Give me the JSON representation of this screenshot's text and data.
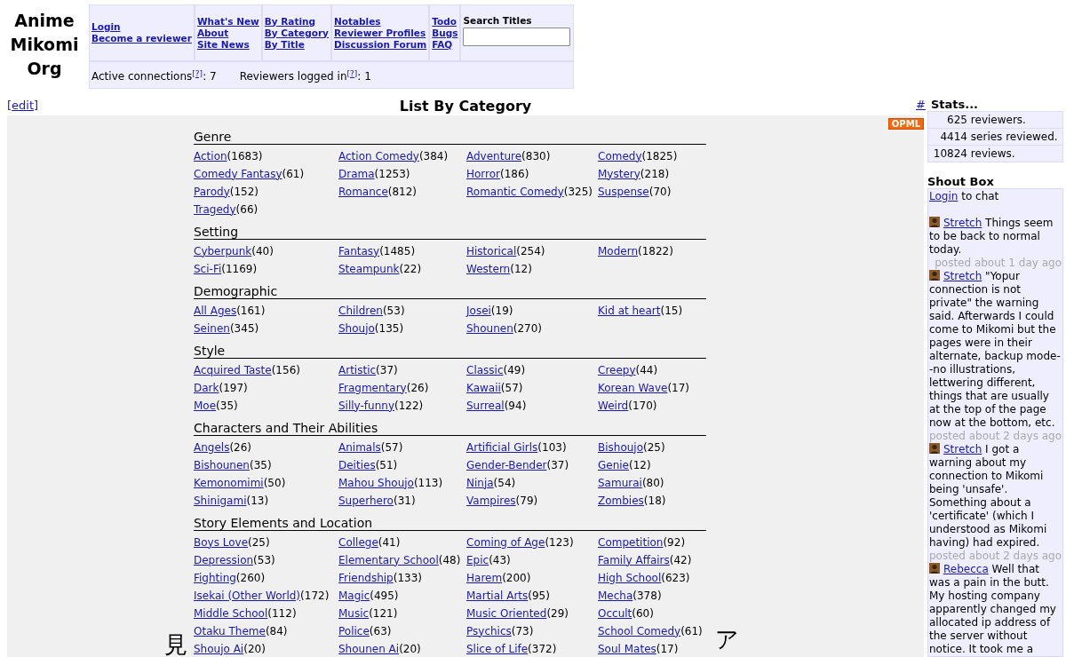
{
  "logo": "Anime Mikomi Org",
  "nav": {
    "groups": [
      [
        "Login",
        "Become a reviewer"
      ],
      [
        "What's New",
        "About",
        "Site News"
      ],
      [
        "By Rating",
        "By Category",
        "By Title"
      ],
      [
        "Notables",
        "Reviewer Profiles",
        "Discussion Forum"
      ],
      [
        "Todo",
        "Bugs",
        "FAQ"
      ]
    ],
    "search": {
      "label": "Search Titles"
    }
  },
  "status": [
    {
      "label": "Active connections",
      "help": "[?]",
      "value": ": 7"
    },
    {
      "label": "Reviewers logged in",
      "help": "[?]",
      "value": ": 1"
    }
  ],
  "edit_link": "[edit]",
  "page_title": "List By Category",
  "opml_badge": "OPML",
  "sections": [
    {
      "title": "Genre",
      "items": [
        {
          "name": "Action",
          "count": "(1683)"
        },
        {
          "name": "Action Comedy",
          "count": "(384)"
        },
        {
          "name": "Adventure",
          "count": "(830)"
        },
        {
          "name": "Comedy",
          "count": "(1825)"
        },
        {
          "name": "Comedy Fantasy",
          "count": "(61)"
        },
        {
          "name": "Drama",
          "count": "(1253)"
        },
        {
          "name": "Horror",
          "count": "(186)"
        },
        {
          "name": "Mystery",
          "count": "(218)"
        },
        {
          "name": "Parody",
          "count": "(152)"
        },
        {
          "name": "Romance",
          "count": "(812)"
        },
        {
          "name": "Romantic Comedy",
          "count": "(325)"
        },
        {
          "name": "Suspense",
          "count": "(70)"
        },
        {
          "name": "Tragedy",
          "count": "(66)"
        }
      ]
    },
    {
      "title": "Setting",
      "items": [
        {
          "name": "Cyberpunk",
          "count": "(40)"
        },
        {
          "name": "Fantasy",
          "count": "(1485)"
        },
        {
          "name": "Historical",
          "count": "(254)"
        },
        {
          "name": "Modern",
          "count": "(1822)"
        },
        {
          "name": "Sci-Fi",
          "count": "(1169)"
        },
        {
          "name": "Steampunk",
          "count": "(22)"
        },
        {
          "name": "Western",
          "count": "(12)"
        }
      ]
    },
    {
      "title": "Demographic",
      "items": [
        {
          "name": "All Ages",
          "count": "(161)"
        },
        {
          "name": "Children",
          "count": "(53)"
        },
        {
          "name": "Josei",
          "count": "(19)"
        },
        {
          "name": "Kid at heart",
          "count": "(15)"
        },
        {
          "name": "Seinen",
          "count": "(345)"
        },
        {
          "name": "Shoujo",
          "count": "(135)"
        },
        {
          "name": "Shounen",
          "count": "(270)"
        }
      ]
    },
    {
      "title": "Style",
      "items": [
        {
          "name": "Acquired Taste",
          "count": "(156)"
        },
        {
          "name": "Artistic",
          "count": "(37)"
        },
        {
          "name": "Classic",
          "count": "(49)"
        },
        {
          "name": "Creepy",
          "count": "(44)"
        },
        {
          "name": "Dark",
          "count": "(197)"
        },
        {
          "name": "Fragmentary",
          "count": "(26)"
        },
        {
          "name": "Kawaii",
          "count": "(57)"
        },
        {
          "name": "Korean Wave",
          "count": "(17)"
        },
        {
          "name": "Moe",
          "count": "(35)"
        },
        {
          "name": "Silly-funny",
          "count": "(122)"
        },
        {
          "name": "Surreal",
          "count": "(94)"
        },
        {
          "name": "Weird",
          "count": "(170)"
        }
      ]
    },
    {
      "title": "Characters and Their Abilities",
      "items": [
        {
          "name": "Angels",
          "count": "(26)"
        },
        {
          "name": "Animals",
          "count": "(57)"
        },
        {
          "name": "Artificial Girls",
          "count": "(103)"
        },
        {
          "name": "Bishoujo",
          "count": "(25)"
        },
        {
          "name": "Bishounen",
          "count": "(35)"
        },
        {
          "name": "Deities",
          "count": "(51)"
        },
        {
          "name": "Gender-Bender",
          "count": "(37)"
        },
        {
          "name": "Genie",
          "count": "(12)"
        },
        {
          "name": "Kemonomimi",
          "count": "(50)"
        },
        {
          "name": "Mahou Shoujo",
          "count": "(113)"
        },
        {
          "name": "Ninja",
          "count": "(54)"
        },
        {
          "name": "Samurai",
          "count": "(80)"
        },
        {
          "name": "Shinigami",
          "count": "(13)"
        },
        {
          "name": "Superhero",
          "count": "(31)"
        },
        {
          "name": "Vampires",
          "count": "(79)"
        },
        {
          "name": "Zombies",
          "count": "(18)"
        }
      ]
    },
    {
      "title": "Story Elements and Location",
      "items": [
        {
          "name": "Boys Love",
          "count": "(25)"
        },
        {
          "name": "College",
          "count": "(41)"
        },
        {
          "name": "Coming of Age",
          "count": "(123)"
        },
        {
          "name": "Competition",
          "count": "(92)"
        },
        {
          "name": "Depression",
          "count": "(53)"
        },
        {
          "name": "Elementary School",
          "count": "(48)"
        },
        {
          "name": "Epic",
          "count": "(43)"
        },
        {
          "name": "Family Affairs",
          "count": "(42)"
        },
        {
          "name": "Fighting",
          "count": "(260)"
        },
        {
          "name": "Friendship",
          "count": "(133)"
        },
        {
          "name": "Harem",
          "count": "(200)"
        },
        {
          "name": "High School",
          "count": "(623)"
        },
        {
          "name": "Isekai (Other World)",
          "count": "(172)"
        },
        {
          "name": "Magic",
          "count": "(495)"
        },
        {
          "name": "Martial Arts",
          "count": "(95)"
        },
        {
          "name": "Mecha",
          "count": "(378)"
        },
        {
          "name": "Middle School",
          "count": "(112)"
        },
        {
          "name": "Music",
          "count": "(121)"
        },
        {
          "name": "Music Oriented",
          "count": "(29)"
        },
        {
          "name": "Occult",
          "count": "(60)"
        },
        {
          "name": "Otaku Theme",
          "count": "(84)"
        },
        {
          "name": "Police",
          "count": "(63)"
        },
        {
          "name": "Psychics",
          "count": "(73)"
        },
        {
          "name": "School Comedy",
          "count": "(61)"
        },
        {
          "name": "Shoujo Ai",
          "count": "(20)"
        },
        {
          "name": "Shounen Ai",
          "count": "(20)"
        },
        {
          "name": "Slice of Life",
          "count": "(372)"
        },
        {
          "name": "Soul Mates",
          "count": "(17)"
        }
      ]
    }
  ],
  "decorations": {
    "left": "見",
    "right": "ア"
  },
  "sidebar": {
    "anchor": "#",
    "stats_title": "Stats...",
    "stats": [
      {
        "count": "625",
        "label": "reviewers."
      },
      {
        "count": "4414",
        "label": "series reviewed."
      },
      {
        "count": "10824",
        "label": "reviews."
      }
    ],
    "shoutbox_title": "Shout Box",
    "login": {
      "link": "Login",
      "text": "to chat"
    },
    "shouts": [
      {
        "author": "Stretch",
        "message": "Things seem to be back to normal today.",
        "posted": "posted about 1 day ago"
      },
      {
        "author": "Stretch",
        "message": "\"Yopur connection is not private\" the warning said. Afterwards I could come to Mikomi but the pages were in their alternate, backup mode--no illustrations, lettwering different, things that are usually at the top of the page now at the bottom, etc.",
        "posted": "posted about 2 days ago"
      },
      {
        "author": "Stretch",
        "message": "I got a warning about my connection to Mikomi being 'unsafe'. Something about a 'certificate' (which I understood as Mikomi having) had expired.",
        "posted": "posted about 2 days ago"
      },
      {
        "author": "Rebecca",
        "message": "Well that was a pain in the butt. My hosting company apparently changed my allocated ip address of the server without notice. It took me a"
      }
    ]
  }
}
